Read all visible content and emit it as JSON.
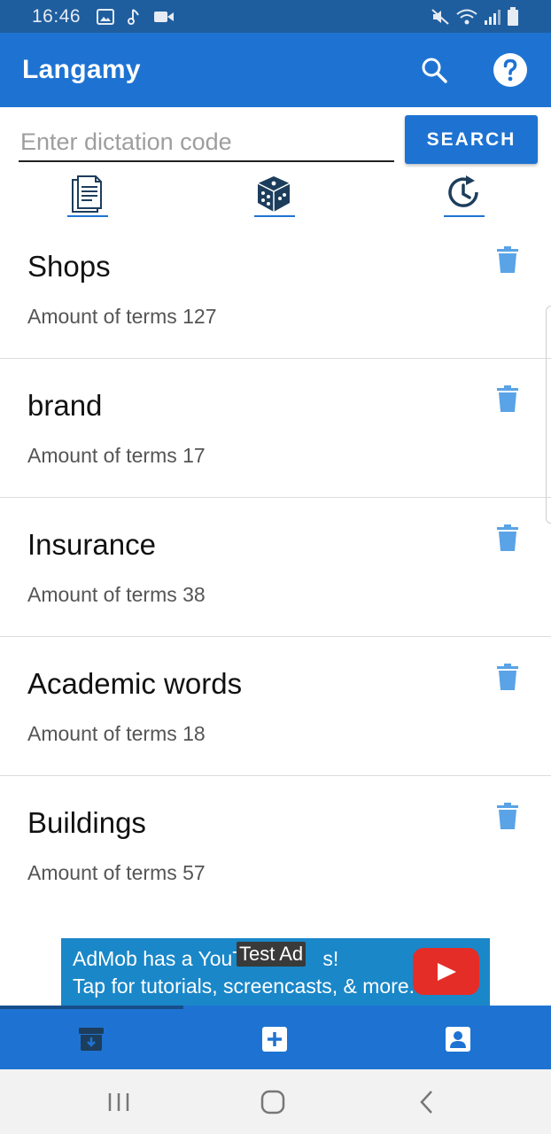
{
  "status_bar": {
    "time": "16:46",
    "left_icons": [
      "image-icon",
      "music-note-icon",
      "video-camera-icon"
    ],
    "right_icons": [
      "mute-icon",
      "wifi-icon",
      "signal-icon",
      "battery-icon"
    ]
  },
  "app_bar": {
    "title": "Langamy",
    "actions": [
      "search-icon",
      "help-icon"
    ]
  },
  "search": {
    "placeholder": "Enter dictation code",
    "value": "",
    "button_label": "SEARCH"
  },
  "tabs": [
    {
      "icon": "document-icon"
    },
    {
      "icon": "dice-icon"
    },
    {
      "icon": "history-icon"
    }
  ],
  "list": {
    "items": [
      {
        "title": "Shops",
        "subtitle": "Amount of terms 127"
      },
      {
        "title": "brand",
        "subtitle": "Amount of terms 17"
      },
      {
        "title": "Insurance",
        "subtitle": "Amount of terms 38"
      },
      {
        "title": "Academic words",
        "subtitle": "Amount of terms 18"
      },
      {
        "title": "Buildings",
        "subtitle": "Amount of terms 57"
      }
    ]
  },
  "ad": {
    "line1": "AdMob has a YouT",
    "line1_tail": "s!",
    "line2": "Tap for tutorials, screencasts, & more.",
    "label": "Test Ad"
  },
  "bottom_nav": {
    "items": [
      "archive-icon",
      "add-icon",
      "profile-icon"
    ]
  },
  "colors": {
    "primary": "#1e73d2",
    "status_bar": "#1f5e9e",
    "delete_icon": "#5aa3e6",
    "tab_icon": "#1d3d5c"
  }
}
